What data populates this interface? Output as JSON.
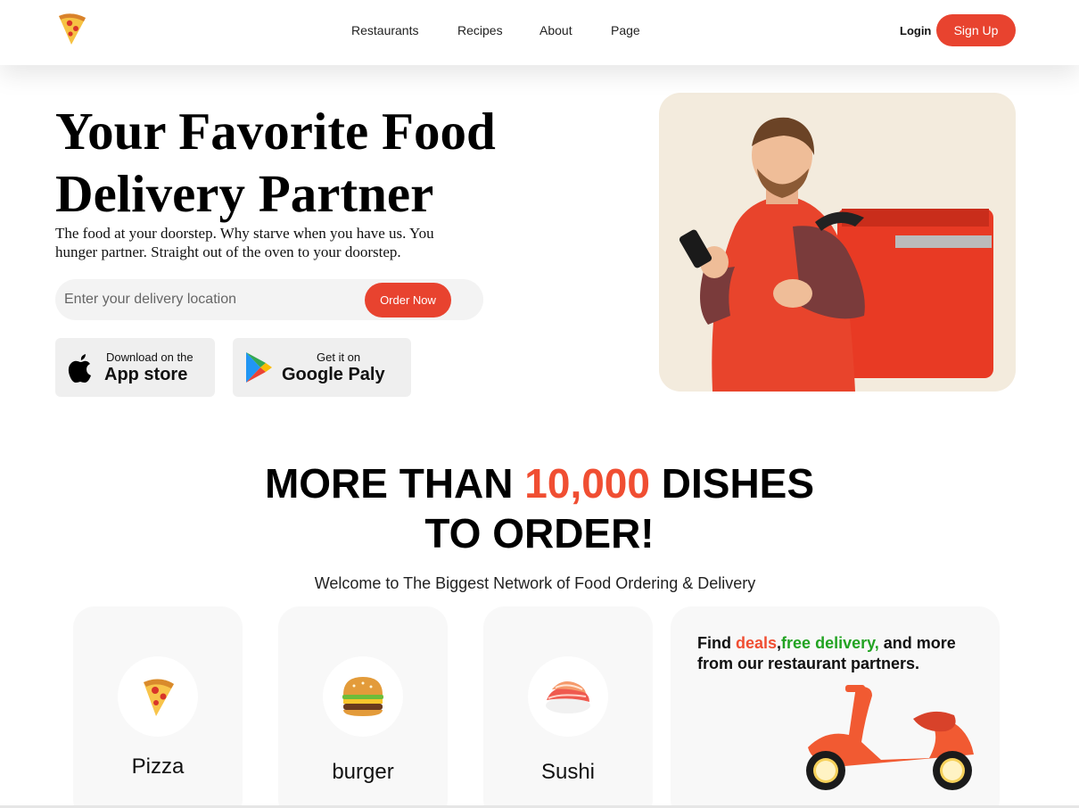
{
  "nav": {
    "logo_icon": "pizza-slice-icon",
    "links": [
      "Restaurants",
      "Recipes",
      "About",
      "Page"
    ],
    "login_label": "Login",
    "signup_label": "Sign Up"
  },
  "hero": {
    "title_line1": "Your Favorite Food",
    "title_line2": "Delivery Partner",
    "subtitle": "The food at your doorstep. Why starve when you have us. You hunger partner. Straight out of the oven to your doorstep.",
    "search_placeholder": "Enter your delivery location",
    "order_button": "Order Now",
    "app_store": {
      "small": "Download on the",
      "big": "App store",
      "icon": "apple-icon"
    },
    "google_play": {
      "small": "Get it on",
      "big": "Google Paly",
      "icon": "google-play-icon"
    },
    "image": "delivery-man-with-phone-and-red-bag"
  },
  "dishes": {
    "title_part1": "MORE THAN ",
    "title_accent": "10,000",
    "title_part2": " DISHES",
    "title_line2": "TO ORDER!",
    "subtitle": "Welcome to The Biggest Network of Food Ordering & Delivery",
    "categories": [
      {
        "label": "Pizza",
        "icon": "pizza-icon"
      },
      {
        "label": "burger",
        "icon": "burger-icon"
      },
      {
        "label": "Sushi",
        "icon": "sushi-icon"
      }
    ],
    "promo": {
      "text_find": "Find ",
      "text_deals": "deals",
      "text_comma": ",",
      "text_free": "free delivery,",
      "text_rest": " and more from our restaurant partners.",
      "icon": "scooter-icon"
    }
  },
  "colors": {
    "accent": "#e8432f",
    "green": "#22a322",
    "card_bg": "#f8f8f8"
  }
}
